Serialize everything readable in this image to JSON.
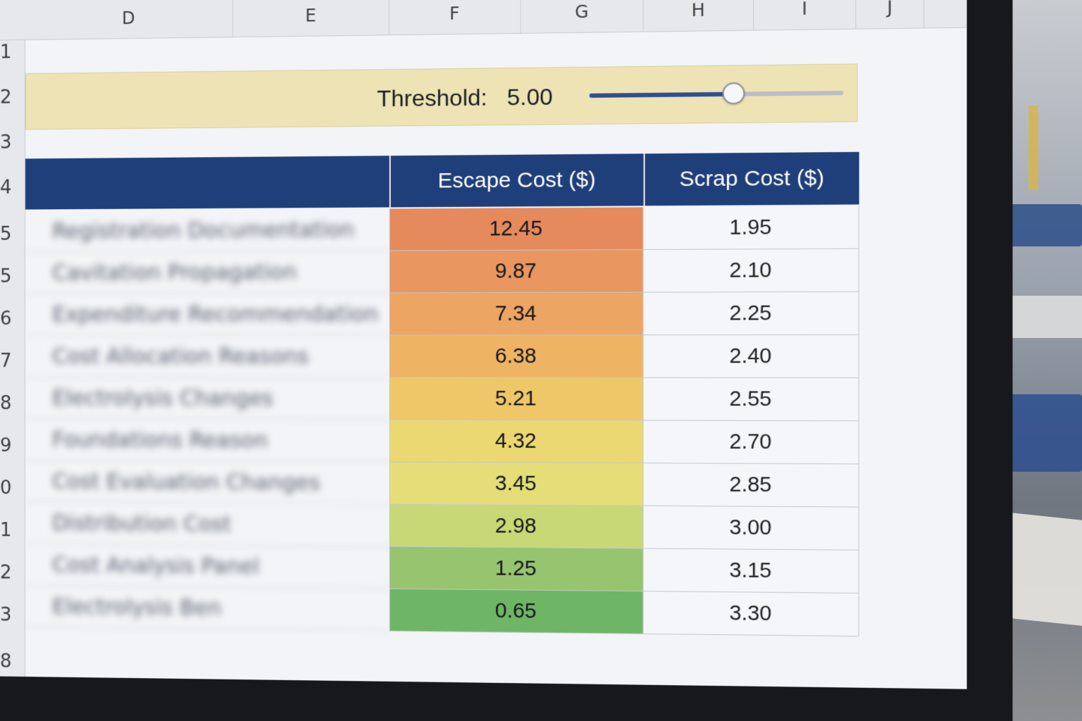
{
  "spreadsheet": {
    "columns": [
      "D",
      "E",
      "F",
      "G",
      "H",
      "I",
      "J"
    ],
    "rows": [
      "1",
      "2",
      "3",
      "4",
      "5",
      "5",
      "6",
      "7",
      "8",
      "9",
      "0",
      "1",
      "2",
      "3",
      "8"
    ]
  },
  "threshold": {
    "label": "Threshold:",
    "value": "5.00",
    "slider_level": 0.57,
    "accent_color": "#2f4f93"
  },
  "table": {
    "headers": {
      "item": "",
      "escape_cost": "Escape Cost ($)",
      "scrap_cost": "Scrap Cost ($)"
    },
    "header_color": "#1f3f7a",
    "rows": [
      {
        "label": "Registration Documentation",
        "escape_cost": "12.45",
        "scrap_cost": "1.95",
        "color": "#e58a5c"
      },
      {
        "label": "Cavitation Propagation",
        "escape_cost": "9.87",
        "scrap_cost": "2.10",
        "color": "#e99660"
      },
      {
        "label": "Expenditure Recommendation",
        "escape_cost": "7.34",
        "scrap_cost": "2.25",
        "color": "#eca562"
      },
      {
        "label": "Cost Allocation Reasons",
        "escape_cost": "6.38",
        "scrap_cost": "2.40",
        "color": "#eeb464"
      },
      {
        "label": "Electrolysis Changes",
        "escape_cost": "5.21",
        "scrap_cost": "2.55",
        "color": "#eec868"
      },
      {
        "label": "Foundations Reason",
        "escape_cost": "4.32",
        "scrap_cost": "2.70",
        "color": "#ecd872"
      },
      {
        "label": "Cost Evaluation Changes",
        "escape_cost": "3.45",
        "scrap_cost": "2.85",
        "color": "#e5de78"
      },
      {
        "label": "Distribution Cost",
        "escape_cost": "2.98",
        "scrap_cost": "3.00",
        "color": "#c9d876"
      },
      {
        "label": "Cost Analysis Panel",
        "escape_cost": "1.25",
        "scrap_cost": "3.15",
        "color": "#97c46e"
      },
      {
        "label": "Electrolysis Ben",
        "escape_cost": "0.65",
        "scrap_cost": "3.30",
        "color": "#6fb566"
      }
    ]
  }
}
